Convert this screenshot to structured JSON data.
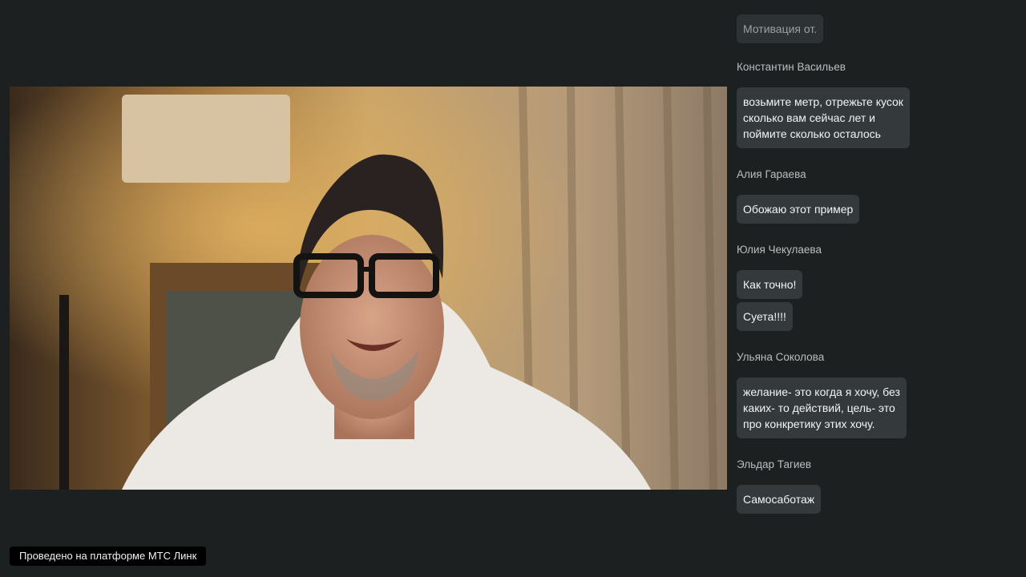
{
  "footer": {
    "platform_label": "Проведено на платформе МТС Линк"
  },
  "chat": {
    "items": [
      {
        "kind": "bubble",
        "text": "Мотивация от.",
        "faded": true
      },
      {
        "kind": "author",
        "text": "Константин Васильев"
      },
      {
        "kind": "bubble",
        "text": "возьмите метр, отрежьте кусок\nсколько вам сейчас лет и\nпоймите сколько осталось"
      },
      {
        "kind": "author",
        "text": "Алия Гараева"
      },
      {
        "kind": "bubble",
        "text": "Обожаю этот пример"
      },
      {
        "kind": "author",
        "text": "Юлия Чекулаева"
      },
      {
        "kind": "bubble",
        "text": "Как точно!"
      },
      {
        "kind": "bubble",
        "text": "Суета!!!!"
      },
      {
        "kind": "author",
        "text": "Ульяна Соколова"
      },
      {
        "kind": "bubble",
        "text": "желание- это когда я хочу, без\nкаких- то действий, цель- это\nпро конкретику этих хочу."
      },
      {
        "kind": "author",
        "text": "Эльдар Тагиев"
      },
      {
        "kind": "bubble",
        "text": "Самосаботаж"
      }
    ]
  }
}
